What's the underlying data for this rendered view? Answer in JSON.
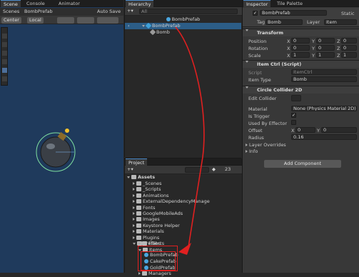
{
  "scene": {
    "tabs": [
      "Scene",
      "Console",
      "Animator"
    ],
    "breadcrumb_root": "Scenes",
    "breadcrumb_item": "BombPrefab",
    "auto_save": "Auto Save",
    "pivot_center": "Center",
    "pivot_local": "Local"
  },
  "hierarchy": {
    "tab": "Hierarchy",
    "search_placeholder": "All",
    "root": "BombPrefab",
    "prefab": "BombPrefab",
    "child": "Bomb"
  },
  "project": {
    "tab": "Project",
    "hidden_count": "23",
    "assets": "Assets",
    "folders": [
      "_Scenes",
      "_Scripts",
      "Animations",
      "ExternalDependencyManage",
      "Fonts",
      "GoogleMobileAds",
      "Images",
      "Keystore Helper",
      "Materials",
      "Plugins",
      "Prefabs"
    ],
    "prefab_sub": [
      "Effects",
      "Items"
    ],
    "items": [
      "BombPrefab",
      "CakePrefab",
      "GoldPrefab"
    ],
    "last_folder": "Managers"
  },
  "inspector": {
    "tabs": [
      "Inspector",
      "Tile Palette"
    ],
    "object_name": "BombPrefab",
    "static_label": "Static",
    "tag_label": "Tag",
    "tag_value": "Bomb",
    "layer_label": "Layer",
    "layer_value": "Item",
    "transform": {
      "title": "Transform",
      "rows": [
        {
          "label": "Position",
          "x": "0",
          "y": "0",
          "z": "0"
        },
        {
          "label": "Rotation",
          "x": "0",
          "y": "0",
          "z": "0"
        },
        {
          "label": "Scale",
          "x": "1",
          "y": "1",
          "z": "1"
        }
      ]
    },
    "item_ctrl": {
      "title": "Item Ctrl (Script)",
      "script_label": "Script",
      "script_value": "ItemCtrl",
      "type_label": "Item Type",
      "type_value": "Bomb"
    },
    "collider": {
      "title": "Circle Collider 2D",
      "edit_label": "Edit Collider",
      "material_label": "Material",
      "material_value": "None (Physics Material 2D)",
      "trigger_label": "Is Trigger",
      "effector_label": "Used By Effector",
      "offset_label": "Offset",
      "offset_x": "0",
      "offset_y": "0",
      "radius_label": "Radius",
      "radius_value": "0.16"
    },
    "layer_overrides": "Layer Overrides",
    "info": "Info",
    "add_component": "Add Component"
  },
  "colors": {
    "scene_bg": "#1f3a5c",
    "highlight_red": "#e02020",
    "selection_blue": "#2c5d87"
  }
}
